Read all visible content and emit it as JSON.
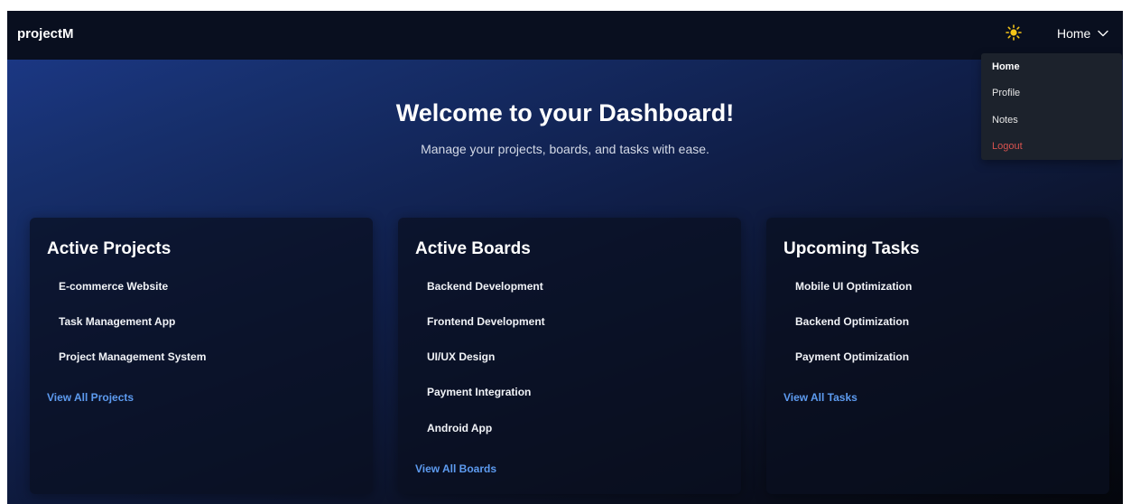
{
  "navbar": {
    "brand": "projectM",
    "theme_icon": "sun-icon",
    "current_menu_label": "Home",
    "menu_icon": "chevron-down-icon"
  },
  "dropdown": {
    "items": [
      {
        "label": "Home",
        "active": true
      },
      {
        "label": "Profile"
      },
      {
        "label": "Notes"
      },
      {
        "label": "Logout",
        "color": "#d9534f"
      }
    ]
  },
  "hero": {
    "title": "Welcome to your Dashboard!",
    "subtitle": "Manage your projects, boards, and tasks with ease."
  },
  "cards": [
    {
      "title": "Active Projects",
      "items": [
        "E-commerce Website",
        "Task Management App",
        "Project Management System"
      ],
      "link": "View All Projects"
    },
    {
      "title": "Active Boards",
      "items": [
        "Backend Development",
        "Frontend Development",
        "UI/UX Design",
        "Payment Integration",
        "Android App"
      ],
      "link": "View All Boards"
    },
    {
      "title": "Upcoming Tasks",
      "items": [
        "Mobile UI Optimization",
        "Backend Optimization",
        "Payment Optimization"
      ],
      "link": "View All Tasks"
    }
  ],
  "colors": {
    "link": "#5d9bf0",
    "logout": "#d9534f",
    "sun": "#f5c518",
    "navbar_bg": "#090f1f"
  }
}
